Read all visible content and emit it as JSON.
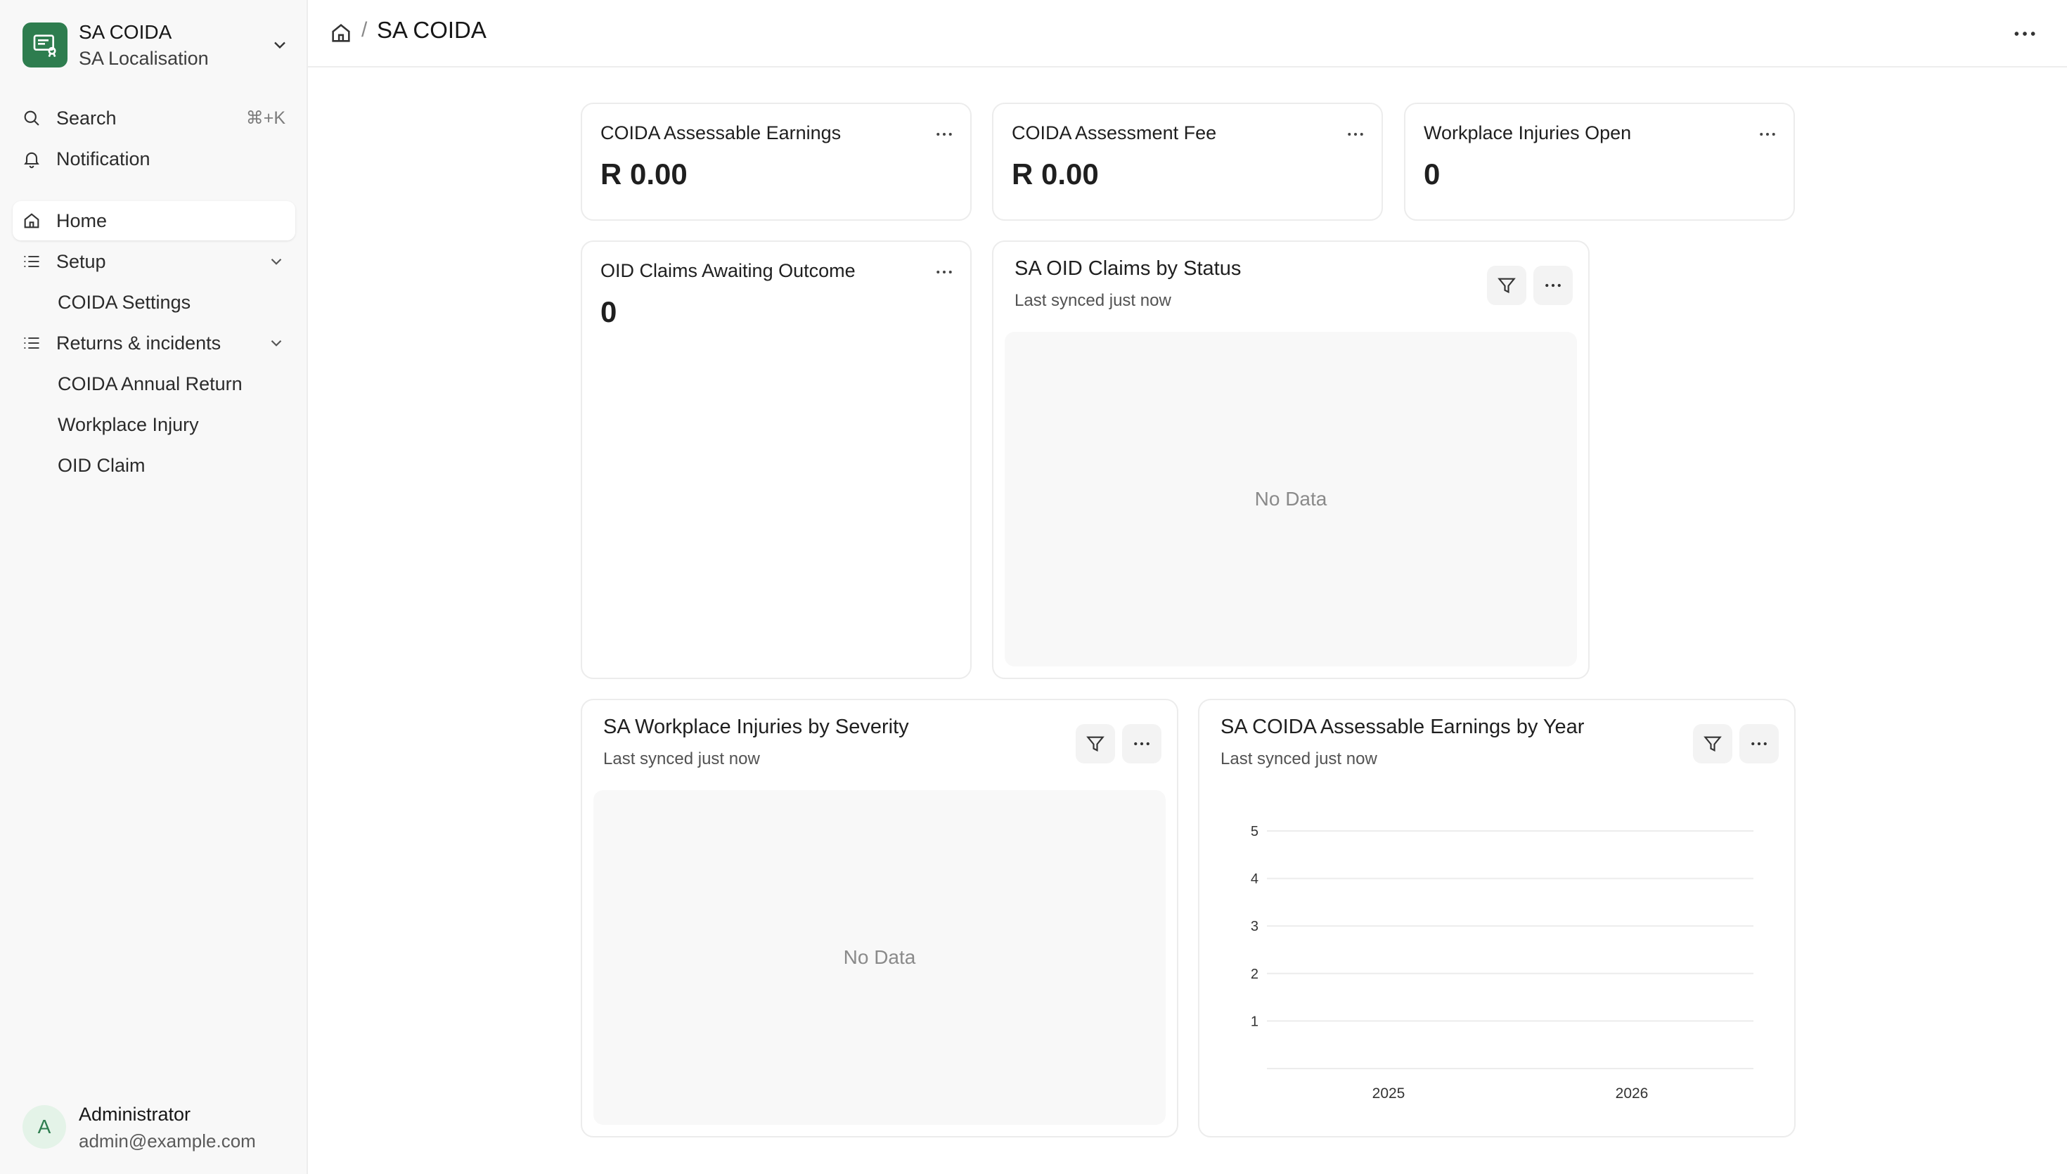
{
  "sidebar": {
    "workspace": {
      "title": "SA COIDA",
      "subtitle": "SA Localisation"
    },
    "search": {
      "label": "Search",
      "shortcut": "⌘+K"
    },
    "notification": {
      "label": "Notification"
    },
    "home": {
      "label": "Home"
    },
    "setup": {
      "label": "Setup",
      "items": [
        "COIDA Settings"
      ]
    },
    "returns": {
      "label": "Returns & incidents",
      "items": [
        "COIDA Annual Return",
        "Workplace Injury",
        "OID Claim"
      ]
    },
    "user": {
      "initial": "A",
      "name": "Administrator",
      "email": "admin@example.com"
    }
  },
  "topbar": {
    "separator": "/",
    "title": "SA COIDA"
  },
  "cards": {
    "earnings": {
      "label": "COIDA Assessable Earnings",
      "value": "R 0.00"
    },
    "fee": {
      "label": "COIDA Assessment Fee",
      "value": "R 0.00"
    },
    "injuries_open": {
      "label": "Workplace Injuries Open",
      "value": "0"
    },
    "claims_awaiting": {
      "label": "OID Claims Awaiting Outcome",
      "value": "0"
    }
  },
  "charts": {
    "claims_status": {
      "title": "SA OID Claims by Status",
      "synced": "Last synced just now",
      "empty": "No Data"
    },
    "injuries_severity": {
      "title": "SA Workplace Injuries by Severity",
      "synced": "Last synced just now",
      "empty": "No Data"
    },
    "earnings_year": {
      "title": "SA COIDA Assessable Earnings by Year",
      "synced": "Last synced just now"
    }
  },
  "chart_data": {
    "type": "bar",
    "title": "SA COIDA Assessable Earnings by Year",
    "categories": [
      "2025",
      "2026"
    ],
    "values": [
      0,
      0
    ],
    "ylim": [
      0,
      5
    ],
    "yticks": [
      1,
      2,
      3,
      4,
      5
    ],
    "grid": true,
    "gridColor": "#ececec"
  },
  "colors": {
    "brand": "#2e7d4f",
    "sidebar_bg": "#f8f8f8",
    "border": "#ececec",
    "muted": "#8a8a8a"
  }
}
